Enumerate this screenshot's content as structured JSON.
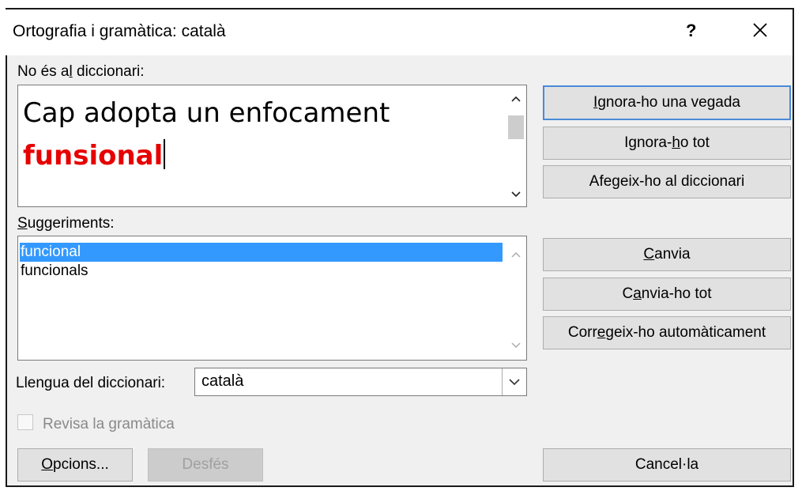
{
  "dialog": {
    "title": "Ortografia i gramàtica: català",
    "help_label": "?",
    "close_icon": "close-icon"
  },
  "not_in_dictionary": {
    "label_before": "No és a",
    "label_underline": "l",
    "label_after": " diccionari:",
    "text_line1": "Cap adopta un enfocament",
    "error_word": "funsional"
  },
  "suggestions": {
    "label_underline": "S",
    "label_rest": "uggeriments:",
    "items": [
      "funcional",
      "funcionals"
    ],
    "selected_index": 0
  },
  "language": {
    "label_before": "Llen",
    "label_underline": "g",
    "label_after": "ua del diccionari:",
    "value": "català"
  },
  "grammar_check": {
    "label": "Revisa la gramàtica",
    "checked": false,
    "enabled": false
  },
  "buttons": {
    "ignore_once": {
      "pre": "",
      "u": "I",
      "post": "gnora-ho una vegada"
    },
    "ignore_all": {
      "pre": "Ignora-",
      "u": "h",
      "post": "o tot"
    },
    "add_dictionary": {
      "pre": "Afe",
      "u": "g",
      "post": "eix-ho al diccionari"
    },
    "change": {
      "pre": "",
      "u": "C",
      "post": "anvia"
    },
    "change_all": {
      "pre": "C",
      "u": "a",
      "post": "nvia-ho tot"
    },
    "autocorrect": {
      "pre": "Corr",
      "u": "e",
      "post": "geix-ho automàticament"
    },
    "options": {
      "pre": "",
      "u": "O",
      "post": "pcions..."
    },
    "undo": {
      "pre": "",
      "u": "",
      "post": "Desfés"
    },
    "cancel": {
      "pre": "",
      "u": "",
      "post": "Cancel·la"
    }
  },
  "colors": {
    "error": "#e60000",
    "selection": "#3399ff",
    "default_button_border": "#4a8ad8"
  }
}
